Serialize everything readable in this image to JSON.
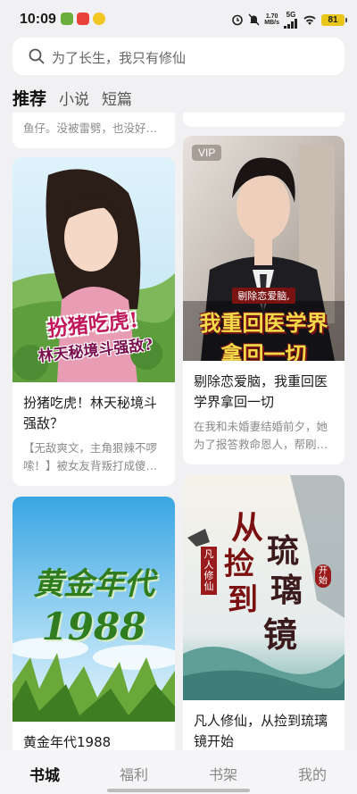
{
  "status_bar": {
    "time": "10:09",
    "net_speed_value": "1.70",
    "net_speed_unit": "MB/s",
    "network": "5G",
    "battery": "81"
  },
  "search": {
    "placeholder": "为了长生，我只有修仙"
  },
  "tabs": [
    {
      "label": "推荐",
      "active": true
    },
    {
      "label": "小说",
      "active": false
    },
    {
      "label": "短篇",
      "active": false
    }
  ],
  "top_partial_card": {
    "desc": "鱼仔。没被雷劈，也没好…"
  },
  "books": [
    {
      "cover_title_line1": "扮猪吃虎!",
      "cover_title_line2": "林天秘境斗强敌?",
      "title_line1": "扮猪吃虎！林天秘境斗",
      "title_line2": "强敌？",
      "desc_line1": "【无敌爽文，主角狠辣不啰",
      "desc_line2": "嗦！】被女友背叛打成傻…"
    },
    {
      "badge": "VIP",
      "cover_title_line1": "剔除恋爱脑,",
      "cover_title_line2": "我重回医学界",
      "cover_title_line3": "拿回一切",
      "title_line1": "剔除恋爱脑，我重回医",
      "title_line2": "学界拿回一切",
      "desc_line1": "在我和未婚妻结婚前夕，她",
      "desc_line2": "为了报答救命恩人，帮刷…"
    },
    {
      "cover_title_line1": "黄金年代",
      "cover_title_line2": "1988",
      "title_line1": "黄金年代1988"
    },
    {
      "cover_seal": "凡人修仙",
      "cover_seal2": "开始",
      "cover_title_a": "从",
      "cover_title_b": "捡",
      "cover_title_c": "到",
      "cover_title_d": "琉",
      "cover_title_e": "璃",
      "cover_title_f": "镜",
      "title_line1": "凡人修仙，从捡到琉璃",
      "title_line2": "镜开始"
    }
  ],
  "bottom_nav": [
    {
      "label": "书城",
      "active": true
    },
    {
      "label": "福利",
      "active": false
    },
    {
      "label": "书架",
      "active": false
    },
    {
      "label": "我的",
      "active": false
    }
  ]
}
